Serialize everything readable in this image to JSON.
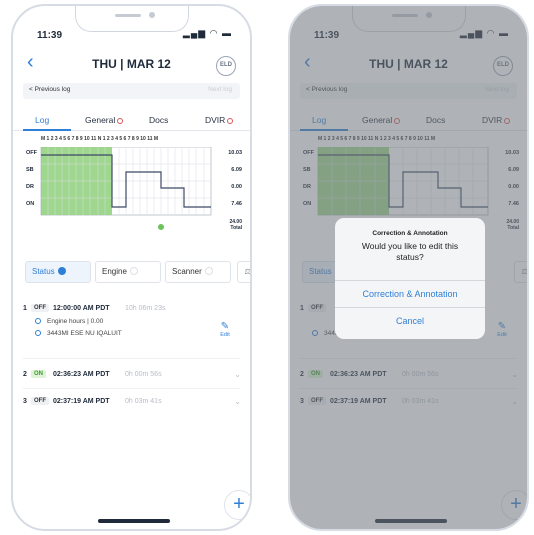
{
  "device": {
    "time": "11:39",
    "status_icons": "▂▄▆ ◠ ▬"
  },
  "header": {
    "back_icon": "chevron-left-icon",
    "date": "THU | MAR 12",
    "badge": "ELD"
  },
  "log_nav": {
    "prev_label": "< Previous log",
    "next_label": "Next log"
  },
  "tabs": [
    {
      "label": "Log"
    },
    {
      "label": "General"
    },
    {
      "label": "Docs"
    },
    {
      "label": "DVIR"
    }
  ],
  "graph": {
    "hour_scale": "M 1 2 3 4 5 6 7 8 9 10 11 N 1 2 3 4 5 6 7 8 9 10 11 M",
    "rows": [
      {
        "label": "OFF",
        "total": "10.03"
      },
      {
        "label": "SB",
        "total": "6.09"
      },
      {
        "label": "DR",
        "total": "0.00"
      },
      {
        "label": "ON",
        "total": "7.46"
      }
    ],
    "total_hours": "24.00",
    "total_label": "Total",
    "colors": {
      "highlight": "#8fd07a",
      "line": "#3c4a66",
      "grid": "#d9dde3"
    }
  },
  "chips": {
    "status": "Status",
    "engine": "Engine",
    "scanner": "Scanner",
    "filter_icon": "⚖"
  },
  "events": [
    {
      "num": "1",
      "status": "OFF",
      "time": "12:00:00 AM PDT",
      "duration": "10h 06m 23s",
      "engine_hours": "Engine hours | 0.00",
      "location": "3443MI ESE NU IQALUIT",
      "edit_label": "Edit"
    },
    {
      "num": "2",
      "status": "ON",
      "time": "02:36:23 AM PDT",
      "duration": "0h 00m 56s"
    },
    {
      "num": "3",
      "status": "OFF",
      "time": "02:37:19 AM PDT",
      "duration": "0h 03m 41s"
    }
  ],
  "fab": {
    "label": "+"
  },
  "dialog": {
    "title": "Correction & Annotation",
    "message": "Would you like to edit this status?",
    "primary": "Correction & Annotation",
    "cancel": "Cancel"
  }
}
